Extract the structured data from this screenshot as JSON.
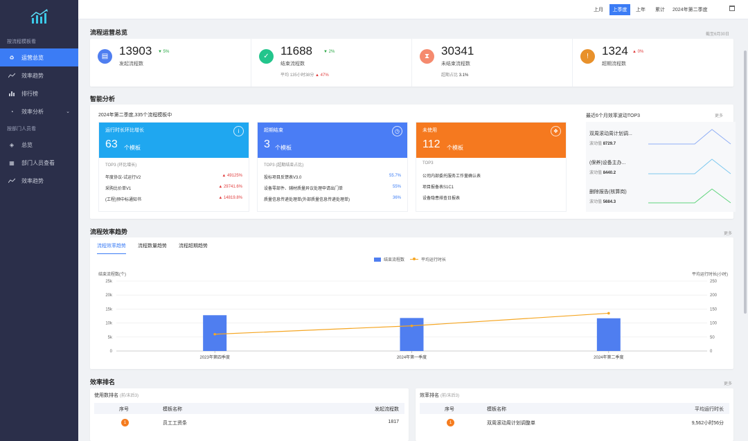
{
  "sidebar": {
    "group1": "按流程模板看",
    "items1": [
      {
        "label": "运营总览",
        "icon": "recycle-icon"
      },
      {
        "label": "效率趋势",
        "icon": "trend-icon"
      },
      {
        "label": "排行榜",
        "icon": "bar-icon"
      },
      {
        "label": "效率分析",
        "icon": "pie-icon"
      }
    ],
    "group2": "按部门人员看",
    "items2": [
      {
        "label": "总览",
        "icon": "layers-icon"
      },
      {
        "label": "部门人员查看",
        "icon": "building-icon"
      },
      {
        "label": "效率趋势",
        "icon": "trend-icon"
      }
    ]
  },
  "topbar": {
    "periods": [
      "上月",
      "上季度",
      "上年",
      "累计"
    ],
    "active_period": "上季度",
    "date_value": "2024年第二季度"
  },
  "overview": {
    "title": "流程运营总览",
    "note": "截至6月30日",
    "kpis": [
      {
        "value": "13903",
        "trend": "▼ 5%",
        "label": "发起流程数",
        "color": "#4f7ef0"
      },
      {
        "value": "11688",
        "trend": "▼ 2%",
        "label": "结束流程数",
        "sub_prefix": "平均",
        "sub_value": "135小时38分",
        "sub_trend": "▲ 47%",
        "color": "#23c58c"
      },
      {
        "value": "30341",
        "trend": "",
        "label": "未结束流程数",
        "sub_prefix": "超期占比",
        "sub_value": "3.1%",
        "color": "#f58a6e"
      },
      {
        "value": "1324",
        "trend": "▲ 0%",
        "label": "超期流程数",
        "color": "#e8912b"
      }
    ]
  },
  "analysis": {
    "title": "智能分析",
    "headline": "2024年第二季度,335个流程模板中",
    "cards": [
      {
        "title": "运行时长环比增长",
        "num": "63",
        "unit": "个模板",
        "sub": "TOP3 (环比增长)",
        "color": "#1fa7f0",
        "rows": [
          {
            "name": "年度协议-试运行V2",
            "value": "▲ 49125%"
          },
          {
            "name": "采购比价单V1",
            "value": "▲ 29741.6%"
          },
          {
            "name": "(工程)预中标通知书",
            "value": "▲ 14819.8%"
          }
        ]
      },
      {
        "title": "超期结束",
        "num": "3",
        "unit": "个模板",
        "sub": "TOP3 (超期结束占比)",
        "color": "#4a7df5",
        "rows": [
          {
            "name": "投标项目反馈表V3.0",
            "value": "55.7%"
          },
          {
            "name": "设备零部件、辅材质量异议处理申请出门单",
            "value": "55%"
          },
          {
            "name": "质量信息传递处理单(外部质量信息传递处理单)",
            "value": "36%"
          }
        ]
      },
      {
        "title": "未使用",
        "num": "112",
        "unit": "个模板",
        "sub": "TOP3",
        "color": "#f5791f",
        "rows": [
          {
            "name": "公司内部委托服务工作量确认表",
            "value": ""
          },
          {
            "name": "项目报备表S1C1",
            "value": ""
          },
          {
            "name": "设备隐患排查日报表",
            "value": ""
          }
        ]
      }
    ],
    "top3": {
      "title": "最近6个月效率波动TOP3",
      "more": "更多",
      "items": [
        {
          "name": "双周滚动周计划调...",
          "label": "波动值",
          "value": "8729.7",
          "color": "#8faef5"
        },
        {
          "name": "(保养)设备主办...",
          "label": "波动值",
          "value": "8440.2",
          "color": "#7cc8ef"
        },
        {
          "name": "删除报告(核算岗)",
          "label": "波动值",
          "value": "5684.3",
          "color": "#5fd47c"
        }
      ]
    }
  },
  "trend": {
    "title": "流程效率趋势",
    "more": "更多",
    "tabs": [
      "流程效率趋势",
      "流程数量趋势",
      "流程超期趋势"
    ]
  },
  "chart_data": {
    "type": "bar",
    "categories": [
      "2023年第四季度",
      "2024年第一季度",
      "2024年第二季度"
    ],
    "series": [
      {
        "name": "结束流程数",
        "type": "bar",
        "axis": "left",
        "values": [
          12800,
          11800,
          11700
        ],
        "color": "#4f7ef0"
      },
      {
        "name": "平均运行时长",
        "type": "line",
        "axis": "right",
        "values": [
          60,
          90,
          135
        ],
        "color": "#f5a623"
      }
    ],
    "ylabel": "结束流程数(个)",
    "y2label": "平均运行时长(小时)",
    "ylim": [
      0,
      25000
    ],
    "y2lim": [
      0,
      250
    ],
    "yticks": [
      "0",
      "5k",
      "10k",
      "15k",
      "20k",
      "25k"
    ],
    "y2ticks": [
      "0",
      "50",
      "100",
      "150",
      "200",
      "250"
    ],
    "grid": true,
    "legend": "top-center"
  },
  "ranking": {
    "title": "效率排名",
    "more": "更多",
    "left": {
      "title": "使用数排名",
      "title_note": "(前/末后3)",
      "headers": [
        "序号",
        "模板名称",
        "发起流程数"
      ],
      "rows": [
        {
          "rank": "1",
          "name": "员工工资条",
          "value": "1817"
        }
      ]
    },
    "right": {
      "title": "效率排名",
      "title_note": "(前/末后3)",
      "headers": [
        "序号",
        "模板名称",
        "平均运行时长"
      ],
      "rows": [
        {
          "rank": "1",
          "name": "双周滚动周计划调整单",
          "value": "9,562小时56分"
        }
      ]
    }
  }
}
